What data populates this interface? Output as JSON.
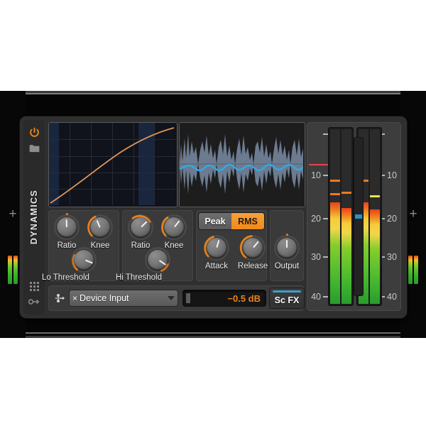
{
  "app": {
    "device_name": "DYNAMICS",
    "panel_bg": "#2f2f2f",
    "accent": "#e8821e",
    "accent_blue": "#3d9ecb"
  },
  "sidebar": {
    "power_icon": "power-icon",
    "folder_icon": "folder-icon",
    "grid_icon": "grid-dots-icon",
    "key_icon": "key-icon",
    "title": "DYNAMICS"
  },
  "displays": {
    "transfer_curve": {
      "name": "transfer-curve-display",
      "bg": "#10131c",
      "curve_color": "#e09556",
      "grid_color": "#272b36",
      "band_color": "#1b2a44"
    },
    "waveform": {
      "name": "waveform-display",
      "bg": "#1d1d1d",
      "wave_color": "#6c7b90",
      "gr_line_color": "#35a8e0"
    }
  },
  "controls": {
    "lo_group": {
      "ratio_label": "Ratio",
      "knee_label": "Knee",
      "threshold_label": "Lo Threshold",
      "ratio_angle": -2,
      "knee_angle": -22,
      "threshold_angle": -38,
      "ratio_arc": 0,
      "knee_arc": 62,
      "threshold_arc": 46
    },
    "hi_group": {
      "ratio_label": "Ratio",
      "knee_label": "Knee",
      "threshold_label": "Hi Threshold",
      "ratio_angle": 46,
      "knee_angle": 38,
      "threshold_angle": 55,
      "ratio_arc": 70,
      "knee_arc": 60,
      "threshold_arc": 28
    },
    "detector": {
      "peak_label": "Peak",
      "rms_label": "RMS",
      "selected": "RMS"
    },
    "envelope": {
      "attack_label": "Attack",
      "release_label": "Release",
      "attack_angle": 16,
      "release_angle": 40,
      "attack_arc": 72,
      "release_arc": 86
    },
    "output": {
      "output_label": "Output",
      "output_angle": 0,
      "output_arc": 0
    }
  },
  "bottom_bar": {
    "sidechain_icon": "sidechain-routing-icon",
    "remove_label": "×",
    "source_value": "Device Input",
    "source_placeholder": "Device Input",
    "dropdown_icon": "chevron-down-icon",
    "gain_value": "−0.5 dB",
    "scfx_label": "Sc FX",
    "scfx_active": true
  },
  "meters": {
    "scale_labels": [
      "10",
      "20",
      "30",
      "40"
    ],
    "scale_positions_pct": [
      27,
      50,
      70,
      91
    ],
    "top_tick_pct": 8,
    "pair_a": {
      "name": "input-meter-pair",
      "levels_pct": [
        58,
        56
      ],
      "hold_pct": [
        70,
        66
      ],
      "hold_colors": [
        "#f0791c",
        "#f0791c"
      ]
    },
    "pair_b": {
      "name": "output-meter-pair",
      "levels_pct": [
        58,
        55
      ],
      "hold_pct": [
        70,
        62
      ],
      "hold_colors": [
        "#f0791c",
        "#efe04a"
      ]
    },
    "gain_reduction": {
      "name": "gain-reduction-meter",
      "marker_pct": 50
    },
    "peak_line_pct": 25
  },
  "rails": {
    "add_icon": "+",
    "left_meter": "left-channel-strip-meter",
    "right_meter": "right-channel-strip-meter"
  }
}
